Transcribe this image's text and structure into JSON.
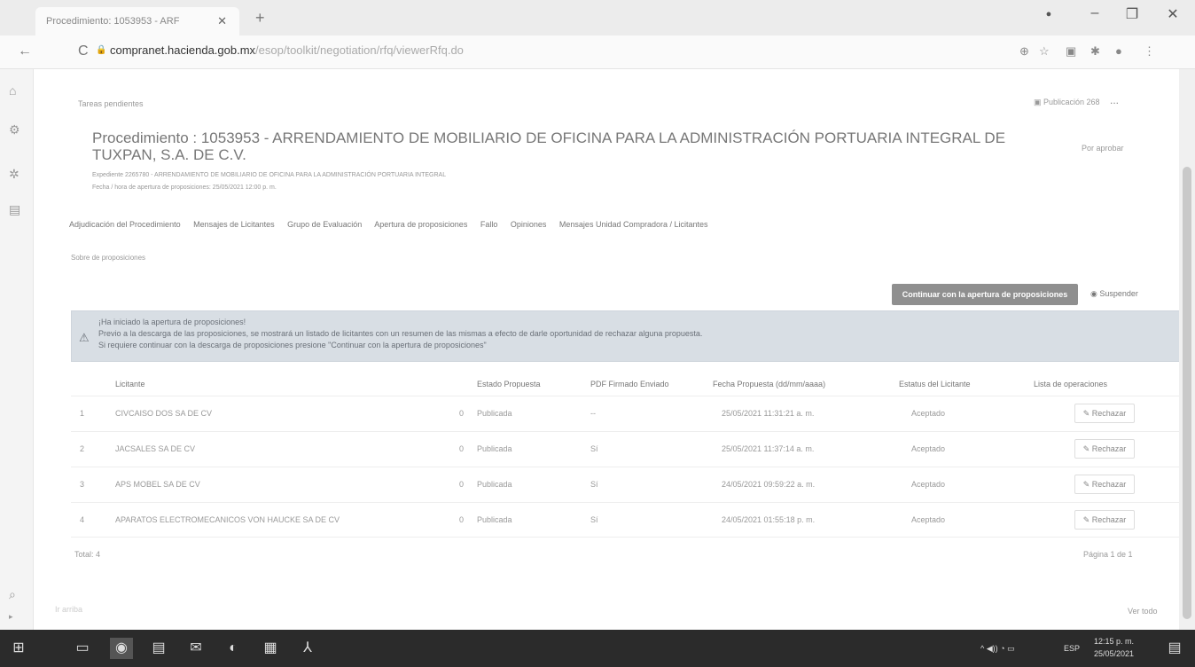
{
  "browser": {
    "tab_title": "Procedimiento: 1053953 - ARF",
    "tab_close": "✕",
    "new_tab": "+",
    "url_host": "compranet.hacienda.gob.mx",
    "url_path": "/esop/toolkit/negotiation/rfq/viewerRfq.do",
    "win_min": "–",
    "win_max": "❐",
    "win_close": "✕",
    "back": "←",
    "reload": "C",
    "lock": "🔒"
  },
  "header": {
    "breadcrumb": "Tareas pendientes",
    "publish_label": "Publicación 268",
    "more": "...",
    "title": "Procedimiento : 1053953 - ARRENDAMIENTO DE MOBILIARIO DE OFICINA PARA LA ADMINISTRACIÓN PORTUARIA INTEGRAL DE TUXPAN, S.A. DE C.V.",
    "right_label": "Por aprobar",
    "sub1": "Expediente 2265780 - ARRENDAMIENTO DE MOBILIARIO DE OFICINA PARA LA ADMINISTRACIÓN PORTUARIA INTEGRAL",
    "sub2": "Fecha / hora de apertura de proposiciones: 25/05/2021 12:00 p. m."
  },
  "nav_tabs": [
    "Adjudicación del Procedimiento",
    "Mensajes de Licitantes",
    "Grupo de Evaluación",
    "Apertura de proposiciones",
    "Fallo",
    "Opiniones",
    "Mensajes Unidad Compradora / Licitantes"
  ],
  "section_link": "Sobre de proposiciones",
  "actions": {
    "continue_button": "Continuar con la apertura de proposiciones",
    "suspend_label": "Suspender"
  },
  "alert": {
    "line1": "¡Ha iniciado la apertura de proposiciones!",
    "line2": "Previo a la descarga de las proposiciones, se mostrará un listado de licitantes con un resumen de las mismas a efecto de darle oportunidad de rechazar alguna propuesta.",
    "line3": "Si requiere continuar con la descarga de proposiciones presione \"Continuar con la apertura de proposiciones\""
  },
  "table": {
    "headers": [
      "Licitante",
      "Estado Propuesta",
      "PDF Firmado Enviado",
      "Fecha Propuesta (dd/mm/aaaa)",
      "Estatus del Licitante",
      "Lista de operaciones"
    ],
    "rows": [
      {
        "num": "1",
        "name": "CIVCAISO DOS SA DE CV",
        "count": "0",
        "estado": "Publicada",
        "pdf": "--",
        "fecha": "25/05/2021 11:31:21 a. m.",
        "estatus": "Aceptado",
        "action": "Rechazar"
      },
      {
        "num": "2",
        "name": "JACSALES SA DE CV",
        "count": "0",
        "estado": "Publicada",
        "pdf": "Sí",
        "fecha": "25/05/2021 11:37:14 a. m.",
        "estatus": "Aceptado",
        "action": "Rechazar"
      },
      {
        "num": "3",
        "name": "APS MOBEL SA DE CV",
        "count": "0",
        "estado": "Publicada",
        "pdf": "Sí",
        "fecha": "24/05/2021 09:59:22 a. m.",
        "estatus": "Aceptado",
        "action": "Rechazar"
      },
      {
        "num": "4",
        "name": "APARATOS ELECTROMECANICOS VON HAUCKE SA DE CV",
        "count": "0",
        "estado": "Publicada",
        "pdf": "Sí",
        "fecha": "24/05/2021 01:55:18 p. m.",
        "estatus": "Aceptado",
        "action": "Rechazar"
      }
    ],
    "footer_left": "Total: 4",
    "pagination": "Página 1 de 1"
  },
  "footer": {
    "left": "Ir arriba",
    "right": "Ver todo"
  },
  "taskbar": {
    "lang": "ESP",
    "time": "12:15 p. m.",
    "date": "25/05/2021"
  }
}
